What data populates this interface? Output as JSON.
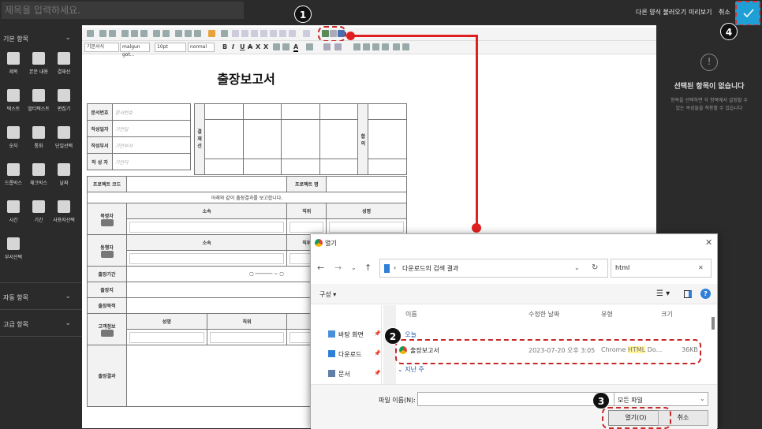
{
  "topbar": {
    "title_placeholder": "제목을 입력하세요.",
    "load_other": "다른 양식 불러오기",
    "preview": "미리보기",
    "cancel": "취소"
  },
  "steps": [
    "1",
    "2",
    "3",
    "4"
  ],
  "leftpanel": {
    "basic_section": "기본 항목",
    "tools": [
      {
        "label": "제목",
        "icon": "title-icon"
      },
      {
        "label": "본문 내용",
        "icon": "content-icon"
      },
      {
        "label": "결재선",
        "icon": "approval-line-icon"
      },
      {
        "label": "텍스트",
        "icon": "text-icon"
      },
      {
        "label": "멀티텍스트",
        "icon": "multitext-icon"
      },
      {
        "label": "편집기",
        "icon": "editor-icon"
      },
      {
        "label": "숫자",
        "icon": "number-icon"
      },
      {
        "label": "통화",
        "icon": "currency-icon"
      },
      {
        "label": "단일선택",
        "icon": "single-select-icon"
      },
      {
        "label": "드롭박스",
        "icon": "dropbox-icon"
      },
      {
        "label": "체크박스",
        "icon": "checkbox-icon"
      },
      {
        "label": "날짜",
        "icon": "date-icon"
      },
      {
        "label": "시간",
        "icon": "time-icon"
      },
      {
        "label": "기간",
        "icon": "period-icon"
      },
      {
        "label": "사용자선택",
        "icon": "user-select-icon"
      },
      {
        "label": "부서선택",
        "icon": "dept-select-icon"
      }
    ],
    "auto_section": "자동 항목",
    "advanced_section": "고급 항목"
  },
  "editor": {
    "toolbar": {
      "style_select": "기본서식",
      "font_select": "malgun got...",
      "size_select": "10pt",
      "weight_select": "normal"
    },
    "form": {
      "title": "출장보고서",
      "doc_rows": [
        {
          "label": "문서번호",
          "placeholder": "문서번호"
        },
        {
          "label": "작성일자",
          "placeholder": "기안일"
        },
        {
          "label": "작성부서",
          "placeholder": "기안부서"
        },
        {
          "label": "작 성 자",
          "placeholder": "기안자"
        }
      ],
      "approval_label": "결재선",
      "agree_label": "합의",
      "project_code": "프로젝트 코드",
      "project_name": "프로젝트 명",
      "report_notice": "아래와 같이 출장결과를 보고합니다.",
      "traveler": "복명자",
      "companion": "동행자",
      "dept": "소속",
      "position": "직위",
      "name": "성명",
      "period": "출장기간",
      "place": "출장지",
      "purpose": "출장목적",
      "customer": "고객정보",
      "company": "업체명",
      "result": "출장결과"
    }
  },
  "rightpanel": {
    "empty_title": "선택된 항목이 없습니다",
    "empty_desc_1": "항목을 선택하면 각 항목에서 설정할 수",
    "empty_desc_2": "있는 속성들을 적용할 수 있습니다"
  },
  "dialog": {
    "title": "열기",
    "path": "다운로드의 검색 결과",
    "search_value": "html",
    "organize": "구성",
    "col_name": "이름",
    "col_modified": "수정한 날짜",
    "col_type": "유형",
    "col_size": "크기",
    "group_today": "오늘",
    "group_last_week": "지난 주",
    "nav": [
      {
        "label": "바탕 화면",
        "icon": "desktop-folder-icon"
      },
      {
        "label": "다운로드",
        "icon": "downloads-folder-icon"
      },
      {
        "label": "문서",
        "icon": "documents-folder-icon"
      }
    ],
    "file": {
      "name": "출장보고서",
      "modified": "2023-07-20 오후 3:05",
      "type_prefix": "Chrome ",
      "type_highlight": "HTML",
      "type_suffix": " Do...",
      "size": "36KB"
    },
    "filename_label": "파일 이름(N):",
    "filetype_select": "모든 파일",
    "open_button": "열기(O)",
    "cancel_button": "취소"
  },
  "colors": {
    "accent": "#1ea0d6",
    "annotation_red": "#e02020",
    "dark_bg": "#2b2b2b"
  }
}
